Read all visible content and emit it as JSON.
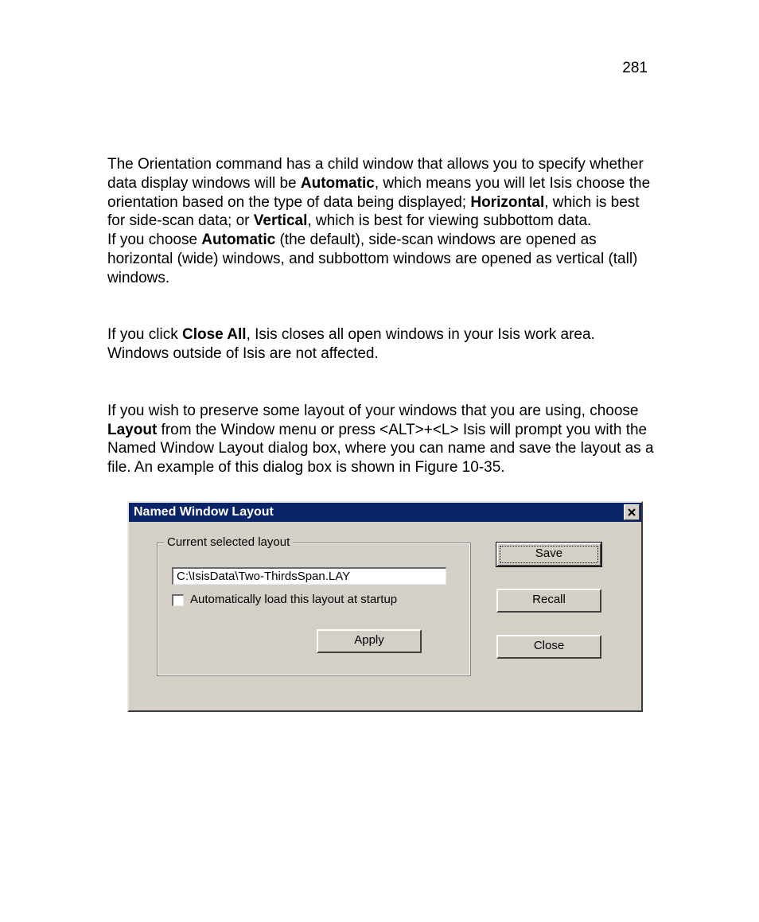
{
  "page_number": "281",
  "paragraphs": {
    "p1_a": "The Orientation command has a child window that allows you to specify whether data display windows will be ",
    "p1_b_bold": "Automatic",
    "p1_c": ", which means you will let Isis choose the orientation based on the type of data being displayed; ",
    "p1_d_bold": "Horizontal",
    "p1_e": ", which is best for side-scan data; or ",
    "p1_f_bold": "Vertical",
    "p1_g": ", which is best for viewing subbottom data.",
    "p2_a": "If you choose ",
    "p2_b_bold": "Automatic",
    "p2_c": " (the default), side-scan windows are opened as horizontal (wide) windows, and subbottom windows are opened as vertical (tall) windows.",
    "p3_a": "If you click ",
    "p3_b_bold": "Close All",
    "p3_c": ", Isis closes all open windows in your Isis work area. Windows outside of Isis are not affected.",
    "p4_a": "If you wish to preserve some layout of your windows that you are using, choose ",
    "p4_b_bold": "Layout",
    "p4_c": " from the Window menu or press <ALT>+<L> Isis will prompt you with the Named Window Layout dialog box, where you can name and save the layout as a file. An example of this dialog box is shown in Figure 10-35."
  },
  "dialog": {
    "title": "Named Window Layout",
    "close_x": "✕",
    "group_legend": "Current selected layout",
    "path_value": "C:\\IsisData\\Two-ThirdsSpan.LAY",
    "checkbox_label": "Automatically load this layout at startup",
    "buttons": {
      "apply": "Apply",
      "save": "Save",
      "recall": "Recall",
      "close": "Close"
    }
  }
}
